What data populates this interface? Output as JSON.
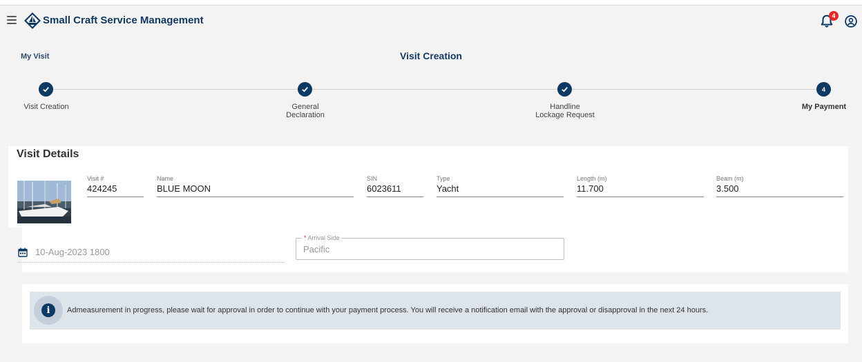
{
  "app": {
    "title": "Small Craft Service Management",
    "notification_count": "4",
    "accent_color": "#0d3a63",
    "badge_color": "#e02b27"
  },
  "breadcrumb": {
    "label": "My Visit"
  },
  "page": {
    "title": "Visit Creation"
  },
  "stepper": {
    "steps": [
      {
        "label": "Visit Creation",
        "state": "completed",
        "indicator": "check-icon"
      },
      {
        "label": "General\nDeclaration",
        "state": "completed",
        "indicator": "check-icon"
      },
      {
        "label": "Handline\nLockage Request",
        "state": "completed",
        "indicator": "check-icon"
      },
      {
        "label": "My Payment",
        "state": "active",
        "number": "4"
      }
    ]
  },
  "visit_details": {
    "title": "Visit Details",
    "fields": {
      "visit_no": {
        "label": "Visit #",
        "value": "424245"
      },
      "name": {
        "label": "Name",
        "value": "BLUE MOON"
      },
      "sin": {
        "label": "SIN",
        "value": "6023611"
      },
      "type": {
        "label": "Type",
        "value": "Yacht"
      },
      "length": {
        "label": "Length (m)",
        "value": "11.700"
      },
      "beam": {
        "label": "Beam (m)",
        "value": "3.500"
      }
    },
    "arrival_date": {
      "value": "10-Aug-2023 1800",
      "icon": "calendar-icon"
    },
    "arrival_side": {
      "required_mark": "*",
      "label": "Arrival Side",
      "value": "Pacific"
    }
  },
  "info": {
    "icon": "info-icon",
    "message": "Admeasurement in progress, please wait for approval in order to continue with your payment process. You will receive a notification email with the approval or disapproval in the next 24 hours."
  }
}
